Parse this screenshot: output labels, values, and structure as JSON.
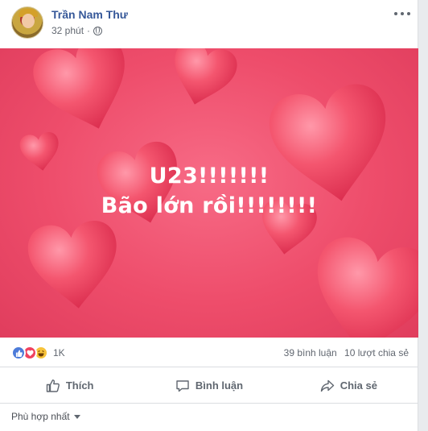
{
  "post": {
    "author": "Trần Nam Thư",
    "time": "32 phút",
    "separator": "·",
    "privacy_icon": "globe-icon",
    "more_icon": "more-options-icon"
  },
  "image": {
    "line1": "U23!!!!!!!",
    "line2": "Bão lớn rồi!!!!!!!!",
    "background_color": "#ee4d6b",
    "heart_color": "#f0546f"
  },
  "reactions": {
    "icons": [
      "like-reaction-icon",
      "love-reaction-icon",
      "haha-reaction-icon"
    ],
    "count": "1K",
    "comments": "39 bình luận",
    "shares": "10 lượt chia sẻ"
  },
  "actions": {
    "like": "Thích",
    "comment": "Bình luận",
    "share": "Chia sẻ"
  },
  "sort": {
    "label": "Phù hợp nhất"
  }
}
